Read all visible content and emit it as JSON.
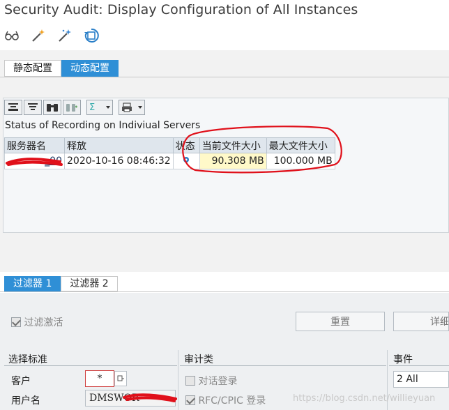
{
  "window": {
    "title": "Security Audit: Display Configuration of All Instances"
  },
  "toolbar": {
    "icons": [
      "glasses-icon",
      "magic-wand-icon",
      "magic-wand-sparkle-icon",
      "refresh-icon"
    ]
  },
  "config_tabs": [
    {
      "label": "静态配置",
      "active": false
    },
    {
      "label": "动态配置",
      "active": true
    }
  ],
  "alv": {
    "toolbar_icons": [
      "align-top-icon",
      "filter-icon",
      "binoculars-icon",
      "binoculars-next-icon",
      "sum-icon",
      "print-icon"
    ],
    "title": "Status of Recording on Indiviual Servers",
    "columns": [
      "服务器名",
      "释放",
      "状态",
      "当前文件大小",
      "最大文件大小"
    ],
    "rows": [
      {
        "server": "_00",
        "release": "2020-10-16 08:46:32",
        "status_icon": "active-status-icon",
        "current_size": "90.308 MB",
        "max_size": "100.000 MB"
      }
    ]
  },
  "filter_tabs": [
    {
      "label": "过滤器 1",
      "active": true
    },
    {
      "label": "过滤器 2",
      "active": false
    }
  ],
  "filter": {
    "active_label": "过滤激活",
    "active_checked": true,
    "reset_label": "重置",
    "detail_label": "详细"
  },
  "criteria": {
    "header": "选择标准",
    "client_label": "客户",
    "client_value": "*",
    "user_label": "用户名",
    "user_value": "DMSWOR"
  },
  "audit_classes": {
    "header": "审计类",
    "items": [
      {
        "label": "对话登录",
        "checked": false
      },
      {
        "label": "RFC/CPIC 登录",
        "checked": true
      }
    ]
  },
  "events": {
    "header": "事件",
    "value": "2 All"
  },
  "watermark": "https://blog.csdn.net/willieyuan",
  "colors": {
    "accent": "#2f8fd6",
    "highlight": "#fff9c9",
    "annotation": "#e0101a"
  }
}
